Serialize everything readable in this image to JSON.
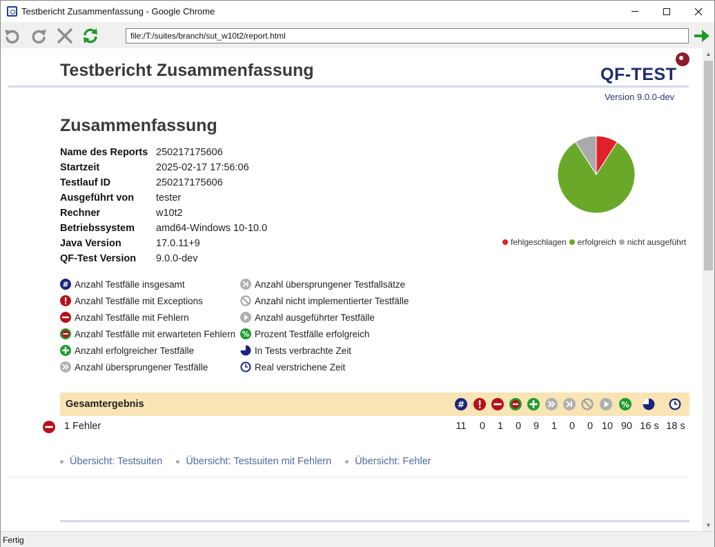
{
  "window": {
    "title": "Testbericht Zusammenfassung - Google Chrome"
  },
  "toolbar": {
    "back_icon": "undo-arrow-icon",
    "forward_icon": "redo-arrow-icon",
    "stop_icon": "close-x-icon",
    "reload_icon": "refresh-icon",
    "url": "file:/T:/suites/branch/sut_w10t2/report.html",
    "go_icon": "go-arrow-icon"
  },
  "report": {
    "title": "Testbericht Zusammenfassung",
    "logo_text": "QF-TEST",
    "version": "Version 9.0.0-dev",
    "section_title": "Zusammenfassung",
    "info": [
      {
        "key": "Name des Reports",
        "value": "250217175606"
      },
      {
        "key": "Startzeit",
        "value": "2025-02-17 17:56:06"
      },
      {
        "key": "Testlauf ID",
        "value": "250217175606"
      },
      {
        "key": "Ausgeführt von",
        "value": "tester"
      },
      {
        "key": "Rechner",
        "value": "w10t2"
      },
      {
        "key": "Betriebssystem",
        "value": "amd64-Windows 10-10.0"
      },
      {
        "key": "Java Version",
        "value": "17.0.11+9"
      },
      {
        "key": "QF-Test Version",
        "value": "9.0.0-dev"
      }
    ],
    "legend_col1": [
      {
        "icon": "count-hash-icon",
        "text": "Anzahl Testfälle insgesamt"
      },
      {
        "icon": "exception-icon",
        "text": "Anzahl Testfälle mit Exceptions"
      },
      {
        "icon": "error-minus-icon",
        "text": "Anzahl Testfälle mit Fehlern"
      },
      {
        "icon": "expected-error-icon",
        "text": "Anzahl Testfälle mit erwarteten Fehlern"
      },
      {
        "icon": "success-plus-icon",
        "text": "Anzahl erfolgreicher Testfälle"
      },
      {
        "icon": "skipped-icon",
        "text": "Anzahl übersprungener Testfälle"
      }
    ],
    "legend_col2": [
      {
        "icon": "skipped-set-icon",
        "text": "Anzahl übersprungener Testfallsätze"
      },
      {
        "icon": "not-implemented-icon",
        "text": "Anzahl nicht implementierter Testfälle"
      },
      {
        "icon": "executed-play-icon",
        "text": "Anzahl ausgeführter Testfälle"
      },
      {
        "icon": "percent-icon",
        "text": "Prozent Testfälle erfolgreich"
      },
      {
        "icon": "test-time-icon",
        "text": "In Tests verbrachte Zeit"
      },
      {
        "icon": "clock-icon",
        "text": "Real verstrichene Zeit"
      }
    ],
    "result": {
      "title": "Gesamtergebnis",
      "row_icon": "error-minus-icon",
      "label": "1 Fehler",
      "values": [
        "11",
        "0",
        "1",
        "0",
        "9",
        "1",
        "0",
        "0",
        "10",
        "90",
        "16 s",
        "18 s"
      ]
    },
    "links": [
      "Übersicht: Testsuiten",
      "Übersicht: Testsuiten mit Fehlern",
      "Übersicht: Fehler"
    ]
  },
  "chart_data": {
    "type": "pie",
    "labels": [
      "fehlgeschlagen",
      "erfolgreich",
      "nicht ausgeführt"
    ],
    "values": [
      1,
      9,
      1
    ],
    "colors": [
      "#e0202a",
      "#6aa82a",
      "#aaaaaa"
    ]
  },
  "status": {
    "text": "Fertig"
  }
}
